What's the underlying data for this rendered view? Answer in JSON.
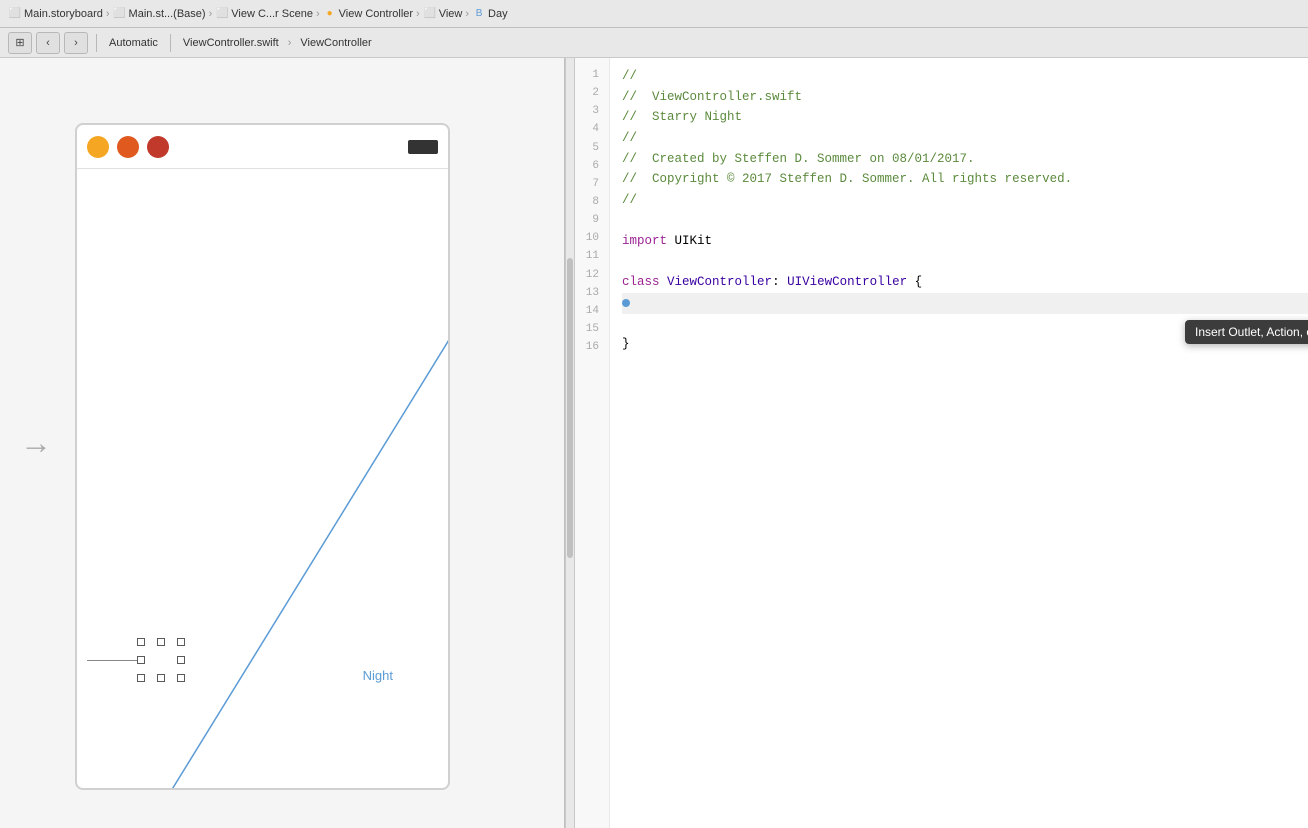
{
  "topbar": {
    "breadcrumbs": [
      {
        "icon": "storyboard",
        "label": "Main.storyboard",
        "color": "#f5a623"
      },
      {
        "icon": "storyboard-base",
        "label": "Main.st...(Base)",
        "color": "#f5a623"
      },
      {
        "icon": "scene",
        "label": "View C...r Scene",
        "color": "#f5a623"
      },
      {
        "icon": "viewcontroller",
        "label": "View Controller",
        "color": "#f5a623"
      },
      {
        "icon": "view",
        "label": "View",
        "color": "#888"
      },
      {
        "icon": "day",
        "label": "Day",
        "color": "#5b9bd5"
      }
    ]
  },
  "toolbar": {
    "back_btn": "‹",
    "forward_btn": "›",
    "scheme_label": "Automatic",
    "file_label": "ViewController.swift",
    "class_label": "ViewController"
  },
  "iphone": {
    "night_label": "Night"
  },
  "code": {
    "lines": [
      {
        "num": 1,
        "text": "//",
        "type": "comment"
      },
      {
        "num": 2,
        "text": "//  ViewController.swift",
        "type": "comment"
      },
      {
        "num": 3,
        "text": "//  Starry Night",
        "type": "comment"
      },
      {
        "num": 4,
        "text": "//",
        "type": "comment"
      },
      {
        "num": 5,
        "text": "//  Created by Steffen D. Sommer on 08/01/2017.",
        "type": "comment"
      },
      {
        "num": 6,
        "text": "//  Copyright © 2017 Steffen D. Sommer. All rights reserved.",
        "type": "comment"
      },
      {
        "num": 7,
        "text": "//",
        "type": "comment"
      },
      {
        "num": 8,
        "text": "",
        "type": "plain"
      },
      {
        "num": 9,
        "text": "import UIKit",
        "type": "import"
      },
      {
        "num": 10,
        "text": "",
        "type": "plain"
      },
      {
        "num": 11,
        "text": "class ViewController: UIViewController {",
        "type": "class"
      },
      {
        "num": 12,
        "text": "",
        "type": "highlighted"
      },
      {
        "num": 13,
        "text": "",
        "type": "plain"
      },
      {
        "num": 14,
        "text": "}",
        "type": "plain"
      },
      {
        "num": 15,
        "text": "",
        "type": "plain"
      },
      {
        "num": 16,
        "text": "",
        "type": "plain"
      }
    ]
  },
  "tooltip": {
    "text": "Insert Outlet, Action, or Outlet Collection"
  }
}
